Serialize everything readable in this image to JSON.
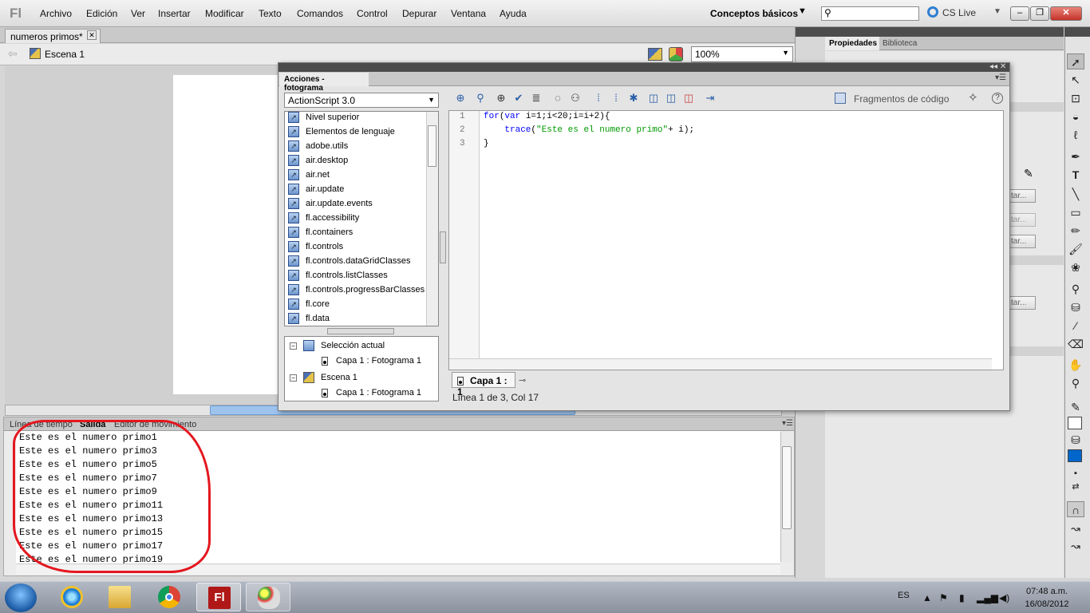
{
  "app": {
    "logo": "Fl",
    "menu": [
      "Archivo",
      "Edición",
      "Ver",
      "Insertar",
      "Modificar",
      "Texto",
      "Comandos",
      "Control",
      "Depurar",
      "Ventana",
      "Ayuda"
    ],
    "workspace": "Conceptos básicos",
    "search_value": "",
    "cs_live": "CS Live"
  },
  "document": {
    "tab_title": "numeros primos*",
    "scene": "Escena 1",
    "zoom": "100%"
  },
  "actions_panel": {
    "tab": "Acciones - fotograma",
    "language": "ActionScript 3.0",
    "toolbox_items": [
      "Nivel superior",
      "Elementos de lenguaje",
      "adobe.utils",
      "air.desktop",
      "air.net",
      "air.update",
      "air.update.events",
      "fl.accessibility",
      "fl.containers",
      "fl.controls",
      "fl.controls.dataGridClasses",
      "fl.controls.listClasses",
      "fl.controls.progressBarClasses",
      "fl.core",
      "fl.data"
    ],
    "tree": [
      {
        "label": "Selección actual",
        "level": 0,
        "expander": "−"
      },
      {
        "label": "Capa 1 : Fotograma 1",
        "level": 1
      },
      {
        "label": "Escena 1",
        "level": 0,
        "expander": "−"
      },
      {
        "label": "Capa 1 : Fotograma 1",
        "level": 1
      }
    ],
    "snippets": "Fragmentos de código",
    "code_lines": [
      {
        "num": "1",
        "kw": "for",
        "pre": "(",
        "kw2": "var",
        "rest": " i=1;i<20;i=i+2){"
      },
      {
        "num": "2",
        "indent": "    ",
        "kw": "trace",
        "pre": "(",
        "str": "\"Este es el numero primo\"",
        "rest": "+ i);"
      },
      {
        "num": "3",
        "rest": "}"
      }
    ],
    "code_tab": "Capa 1 : 1",
    "status": "Línea 1 de 3, Col 17"
  },
  "bottom_panel": {
    "tabs": [
      "Línea de tiempo",
      "Salida",
      "Editor de movimiento"
    ],
    "output_lines": [
      "Este es el numero primo1",
      "Este es el numero primo3",
      "Este es el numero primo5",
      "Este es el numero primo7",
      "Este es el numero primo9",
      "Este es el numero primo11",
      "Este es el numero primo13",
      "Este es el numero primo15",
      "Este es el numero primo17",
      "Este es el numero primo19"
    ]
  },
  "properties_panel": {
    "tabs": [
      "Propiedades",
      "Biblioteca"
    ],
    "button_label": "tar..."
  },
  "taskbar": {
    "language": "ES",
    "time": "07:48 a.m.",
    "date": "16/08/2012"
  },
  "colors": {
    "annotation": "#e4171f",
    "fill_color": "#0066cc",
    "keyword": "#0000ff",
    "string": "#009900"
  }
}
